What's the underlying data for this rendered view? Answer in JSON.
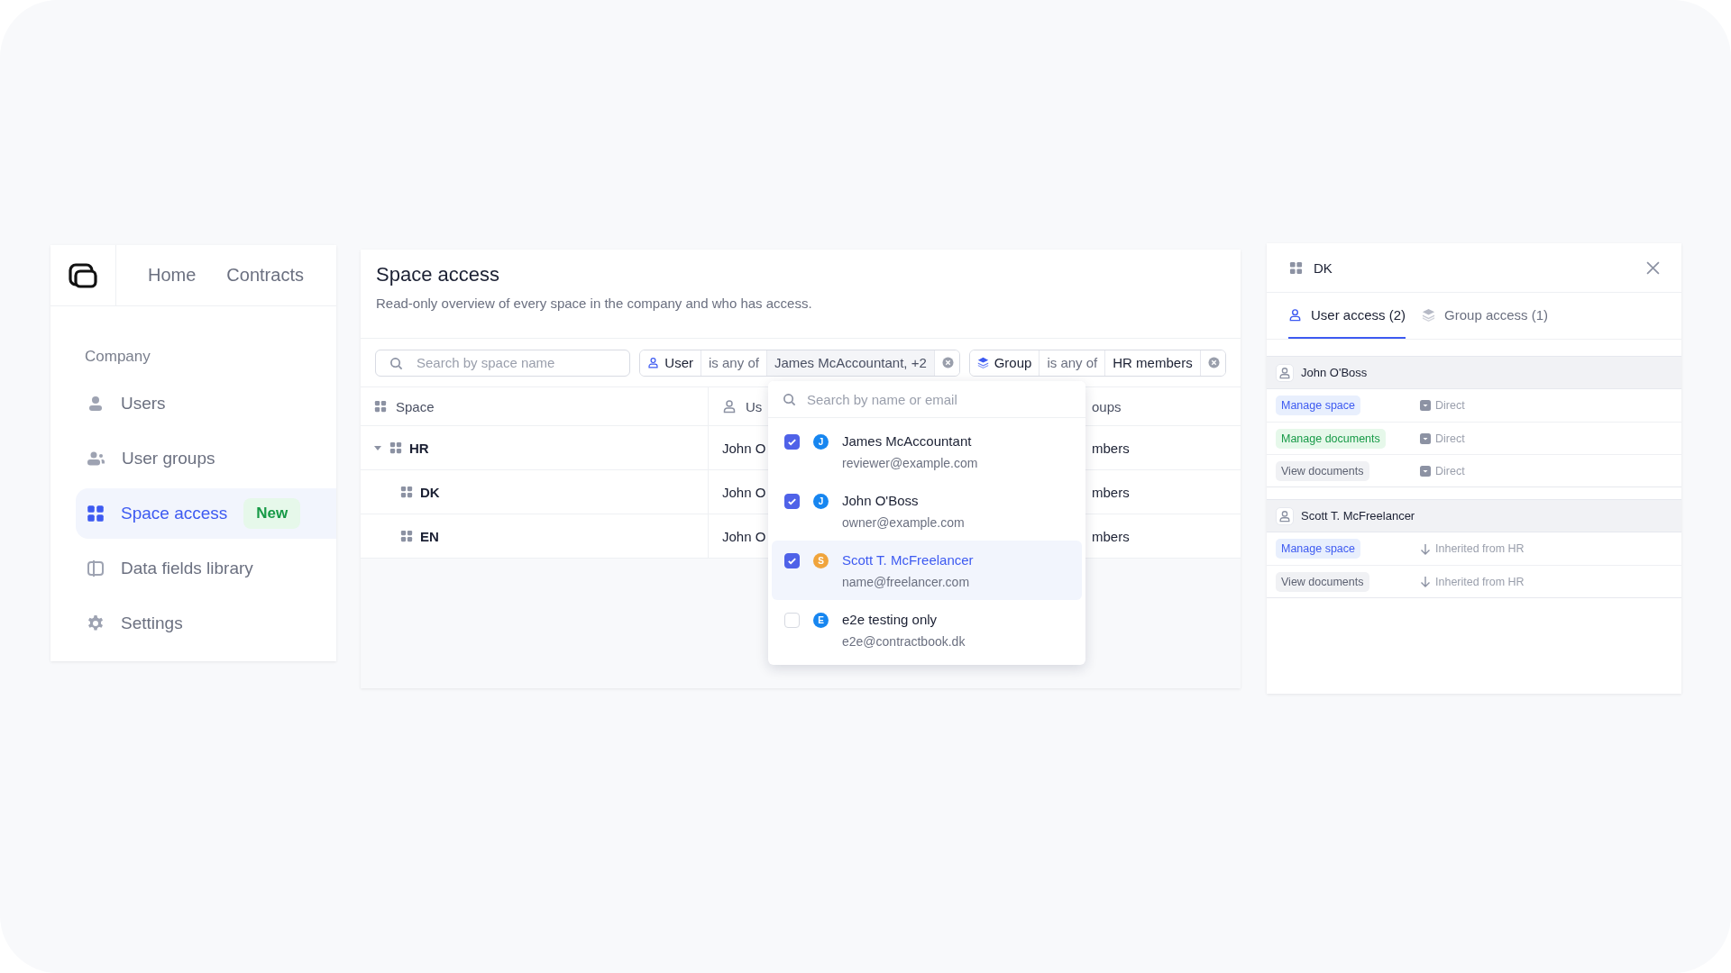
{
  "nav": {
    "tabs": [
      {
        "label": "Home"
      },
      {
        "label": "Contracts"
      }
    ]
  },
  "sidebar": {
    "section": "Company",
    "items": [
      {
        "label": "Users",
        "selected": false
      },
      {
        "label": "User groups",
        "selected": false
      },
      {
        "label": "Space access",
        "selected": true,
        "badge": "New"
      },
      {
        "label": "Data fields library",
        "selected": false
      },
      {
        "label": "Settings",
        "selected": false
      }
    ]
  },
  "page": {
    "title": "Space access",
    "subtitle": "Read-only overview of every space in the company and who has access."
  },
  "filters": {
    "search": {
      "placeholder": "Search by space name"
    },
    "chips": [
      {
        "kind": "user",
        "field": "User",
        "operator": "is any of",
        "value": "James McAccountant, +2"
      },
      {
        "kind": "group",
        "field": "Group",
        "operator": "is any of",
        "value": "HR members"
      }
    ]
  },
  "table": {
    "columns": [
      "Space",
      "Us",
      "oups"
    ],
    "rows": [
      {
        "space": "HR",
        "expanded": true,
        "users": "John O",
        "groups": "mbers",
        "children": [
          {
            "space": "DK",
            "users": "John O",
            "groups": "mbers"
          },
          {
            "space": "EN",
            "users": "John O",
            "groups": "mbers"
          }
        ]
      }
    ]
  },
  "dropdown": {
    "placeholder": "Search by name or email",
    "options": [
      {
        "name": "James McAccountant",
        "email": "reviewer@example.com",
        "initial": "J",
        "color": "#1786f0",
        "checked": true,
        "selected": false
      },
      {
        "name": "John O'Boss",
        "email": "owner@example.com",
        "initial": "J",
        "color": "#1786f0",
        "checked": true,
        "selected": false
      },
      {
        "name": "Scott T. McFreelancer",
        "email": "name@freelancer.com",
        "initial": "S",
        "color": "#f0a43c",
        "checked": true,
        "selected": true
      },
      {
        "name": "e2e testing only",
        "email": "e2e@contractbook.dk",
        "initial": "E",
        "color": "#1786f0",
        "checked": false,
        "selected": false
      }
    ]
  },
  "detail": {
    "title": "DK",
    "tabs": [
      {
        "label": "User access (2)",
        "kind": "user",
        "selected": true
      },
      {
        "label": "Group access (1)",
        "kind": "group",
        "selected": false
      }
    ],
    "users": [
      {
        "name": "John O'Boss",
        "permissions": [
          {
            "label": "Manage space",
            "kind": "manage_space",
            "source": {
              "kind": "direct",
              "label": "Direct"
            }
          },
          {
            "label": "Manage documents",
            "kind": "manage_documents",
            "source": {
              "kind": "direct",
              "label": "Direct"
            }
          },
          {
            "label": "View documents",
            "kind": "view",
            "source": {
              "kind": "direct",
              "label": "Direct"
            }
          }
        ]
      },
      {
        "name": "Scott T. McFreelancer",
        "permissions": [
          {
            "label": "Manage space",
            "kind": "manage_space",
            "source": {
              "kind": "inherited",
              "label": "Inherited from HR"
            }
          },
          {
            "label": "View documents",
            "kind": "view",
            "source": {
              "kind": "inherited",
              "label": "Inherited from HR"
            }
          }
        ]
      }
    ]
  }
}
